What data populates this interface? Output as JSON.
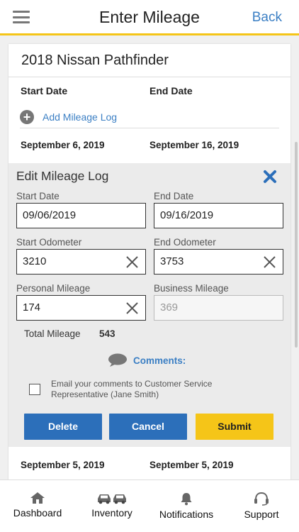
{
  "header": {
    "title": "Enter Mileage",
    "back_label": "Back"
  },
  "vehicle": {
    "name": "2018 Nissan Pathfinder"
  },
  "columns": {
    "start": "Start Date",
    "end": "End Date"
  },
  "add_log_label": "Add Mileage Log",
  "log_rows": [
    {
      "start": "September 6, 2019",
      "end": "September 16, 2019"
    },
    {
      "start": "September 5, 2019",
      "end": "September 5, 2019"
    }
  ],
  "edit": {
    "title": "Edit Mileage Log",
    "start_date_label": "Start Date",
    "start_date_value": "09/06/2019",
    "end_date_label": "End Date",
    "end_date_value": "09/16/2019",
    "start_odo_label": "Start Odometer",
    "start_odo_value": "3210",
    "end_odo_label": "End Odometer",
    "end_odo_value": "3753",
    "personal_label": "Personal Mileage",
    "personal_value": "174",
    "business_label": "Business Mileage",
    "business_value": "369",
    "total_label": "Total Mileage",
    "total_value": "543",
    "comments_label": "Comments:",
    "email_text": "Email your comments to Customer Service Representative (Jane Smith)",
    "email_checked": false,
    "delete_label": "Delete",
    "cancel_label": "Cancel",
    "submit_label": "Submit"
  },
  "tabs": [
    {
      "label": "Dashboard",
      "icon": "house-icon"
    },
    {
      "label": "Inventory",
      "icon": "cars-icon"
    },
    {
      "label": "Notifications",
      "icon": "bell-icon"
    },
    {
      "label": "Support",
      "icon": "headset-icon"
    }
  ],
  "colors": {
    "accent_yellow": "#f5c518",
    "link_blue": "#3b7fc4",
    "button_blue": "#2c6fba"
  }
}
